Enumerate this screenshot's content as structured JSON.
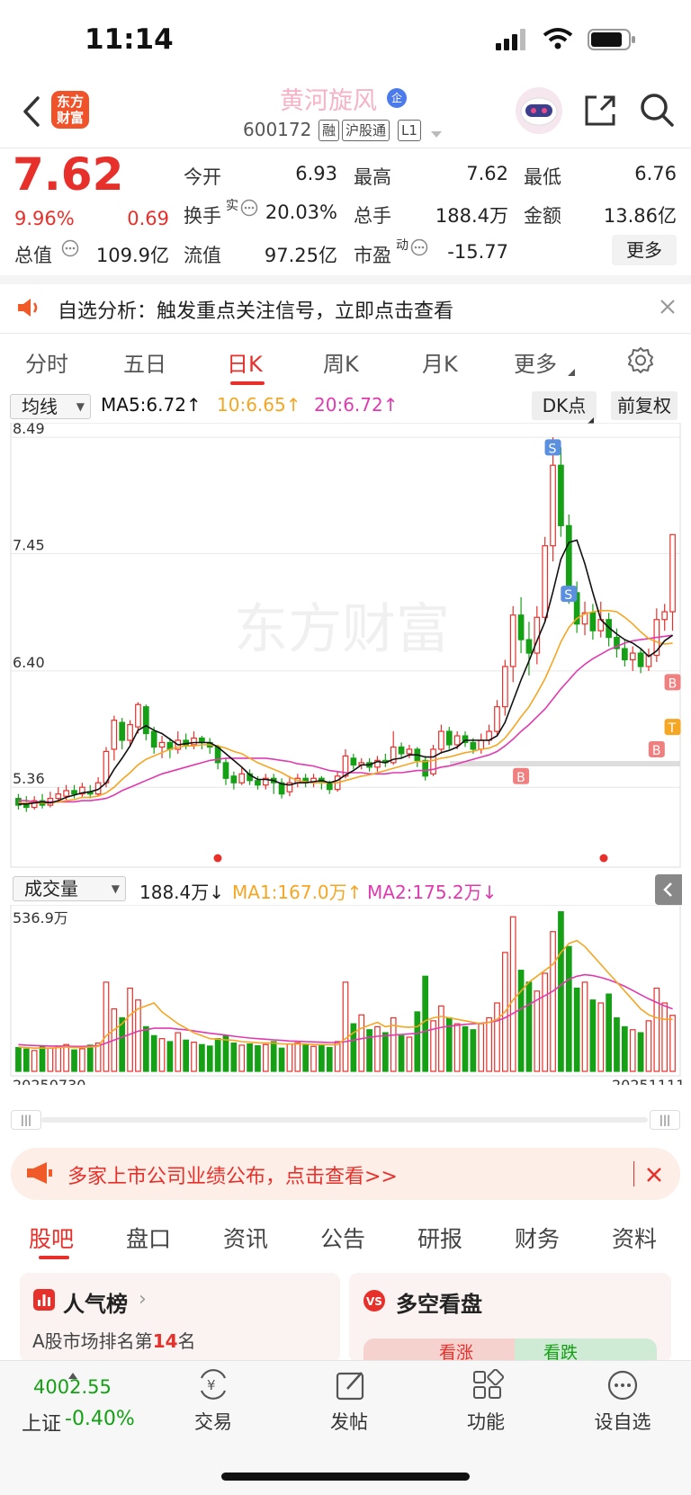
{
  "status_bar": {
    "time": "11:14"
  },
  "header": {
    "logo_text": "东方财富",
    "stock_name": "黄河旋风",
    "name_badge": "企",
    "stock_code": "600172",
    "tags": [
      "融",
      "沪股通",
      "L1"
    ]
  },
  "quote": {
    "price": "7.62",
    "change_pct": "9.96%",
    "change_amt": "0.69",
    "market_cap_label": "总值",
    "market_cap_value": "109.9亿",
    "open_label": "今开",
    "open_value": "6.93",
    "high_label": "最高",
    "high_value": "7.62",
    "low_label": "最低",
    "low_value": "6.76",
    "turnover_label": "换手",
    "turnover_sup": "实",
    "turnover_value": "20.03%",
    "volume_label": "总手",
    "volume_value": "188.4万",
    "amount_label": "金额",
    "amount_value": "13.86亿",
    "float_label": "流值",
    "float_value": "97.25亿",
    "pe_label": "市盈",
    "pe_sup": "动",
    "pe_value": "-15.77",
    "more_button": "更多"
  },
  "notice": {
    "text": "自选分析：触发重点关注信号，立即点击查看"
  },
  "kline_tabs": [
    "分时",
    "五日",
    "日K",
    "周K",
    "月K",
    "更多"
  ],
  "active_kline_tab": "日K",
  "chart_controls": {
    "ma_select": "均线",
    "ma5": "MA5:6.72↑",
    "ma10": "10:6.65↑",
    "ma20": "20:6.72↑",
    "dk_button": "DK点",
    "adjust_button": "前复权",
    "vol_select": "成交量",
    "vol_value": "188.4万↓",
    "vol_ma1": "MA1:167.0万↑",
    "vol_ma2": "MA2:175.2万↓",
    "watermark": "东方财富"
  },
  "colors": {
    "up": "#e8302b",
    "down": "#15a015",
    "ma5": "#111111",
    "ma10": "#f5a623",
    "ma20": "#e03ab0"
  },
  "chart_data": {
    "type": "candlestick",
    "y_ticks": [
      "8.49",
      "7.45",
      "6.40",
      "5.36"
    ],
    "vol_max_label": "536.9万",
    "x_start": "20250730",
    "x_end": "20251111",
    "candles": [
      [
        5.26,
        5.2,
        5.3,
        5.16
      ],
      [
        5.22,
        5.18,
        5.28,
        5.14
      ],
      [
        5.18,
        5.24,
        5.28,
        5.16
      ],
      [
        5.24,
        5.2,
        5.3,
        5.17
      ],
      [
        5.2,
        5.26,
        5.32,
        5.18
      ],
      [
        5.26,
        5.3,
        5.36,
        5.22
      ],
      [
        5.28,
        5.33,
        5.38,
        5.24
      ],
      [
        5.33,
        5.3,
        5.38,
        5.26
      ],
      [
        5.3,
        5.36,
        5.4,
        5.27
      ],
      [
        5.32,
        5.3,
        5.38,
        5.26
      ],
      [
        5.3,
        5.4,
        5.45,
        5.28
      ],
      [
        5.4,
        5.68,
        5.72,
        5.36
      ],
      [
        5.7,
        5.96,
        6.0,
        5.6
      ],
      [
        5.94,
        5.78,
        5.98,
        5.7
      ],
      [
        5.78,
        5.92,
        5.96,
        5.72
      ],
      [
        5.9,
        6.1,
        6.12,
        5.84
      ],
      [
        6.08,
        5.84,
        6.1,
        5.78
      ],
      [
        5.86,
        5.72,
        5.9,
        5.66
      ],
      [
        5.72,
        5.76,
        5.82,
        5.62
      ],
      [
        5.76,
        5.7,
        5.8,
        5.62
      ],
      [
        5.7,
        5.78,
        5.86,
        5.66
      ],
      [
        5.78,
        5.74,
        5.84,
        5.7
      ],
      [
        5.74,
        5.8,
        5.86,
        5.7
      ],
      [
        5.8,
        5.76,
        5.82,
        5.7
      ],
      [
        5.76,
        5.72,
        5.8,
        5.66
      ],
      [
        5.72,
        5.58,
        5.74,
        5.52
      ],
      [
        5.58,
        5.44,
        5.62,
        5.38
      ],
      [
        5.46,
        5.4,
        5.5,
        5.34
      ],
      [
        5.4,
        5.48,
        5.54,
        5.38
      ],
      [
        5.48,
        5.42,
        5.52,
        5.38
      ],
      [
        5.42,
        5.38,
        5.46,
        5.34
      ],
      [
        5.38,
        5.44,
        5.48,
        5.34
      ],
      [
        5.44,
        5.4,
        5.48,
        5.3
      ],
      [
        5.4,
        5.3,
        5.44,
        5.26
      ],
      [
        5.32,
        5.4,
        5.46,
        5.28
      ],
      [
        5.4,
        5.44,
        5.48,
        5.36
      ],
      [
        5.44,
        5.4,
        5.48,
        5.36
      ],
      [
        5.4,
        5.44,
        5.48,
        5.36
      ],
      [
        5.44,
        5.4,
        5.46,
        5.34
      ],
      [
        5.4,
        5.34,
        5.42,
        5.3
      ],
      [
        5.34,
        5.46,
        5.5,
        5.32
      ],
      [
        5.46,
        5.64,
        5.7,
        5.44
      ],
      [
        5.62,
        5.56,
        5.66,
        5.52
      ],
      [
        5.56,
        5.58,
        5.62,
        5.52
      ],
      [
        5.58,
        5.54,
        5.62,
        5.5
      ],
      [
        5.54,
        5.6,
        5.64,
        5.5
      ],
      [
        5.6,
        5.58,
        5.66,
        5.54
      ],
      [
        5.58,
        5.72,
        5.86,
        5.56
      ],
      [
        5.72,
        5.66,
        5.76,
        5.62
      ],
      [
        5.66,
        5.7,
        5.74,
        5.62
      ],
      [
        5.7,
        5.6,
        5.72,
        5.54
      ],
      [
        5.6,
        5.46,
        5.64,
        5.42
      ],
      [
        5.48,
        5.7,
        5.74,
        5.46
      ],
      [
        5.7,
        5.86,
        5.92,
        5.66
      ],
      [
        5.86,
        5.74,
        5.9,
        5.7
      ],
      [
        5.74,
        5.82,
        5.86,
        5.7
      ],
      [
        5.82,
        5.76,
        5.86,
        5.72
      ],
      [
        5.76,
        5.7,
        5.8,
        5.66
      ],
      [
        5.7,
        5.78,
        5.84,
        5.66
      ],
      [
        5.78,
        5.86,
        5.92,
        5.74
      ],
      [
        5.86,
        6.08,
        6.14,
        5.82
      ],
      [
        6.08,
        6.44,
        6.5,
        6.0
      ],
      [
        6.44,
        6.9,
        6.98,
        6.3
      ],
      [
        6.9,
        6.68,
        7.06,
        6.56
      ],
      [
        6.68,
        6.56,
        6.84,
        6.36
      ],
      [
        6.56,
        6.88,
        6.98,
        6.46
      ],
      [
        6.88,
        7.52,
        7.6,
        6.84
      ],
      [
        7.52,
        8.24,
        8.49,
        7.38
      ],
      [
        8.24,
        7.7,
        8.4,
        7.6
      ],
      [
        7.7,
        7.1,
        7.8,
        7.0
      ],
      [
        7.1,
        6.82,
        7.2,
        6.74
      ],
      [
        6.82,
        6.92,
        7.02,
        6.72
      ],
      [
        6.92,
        6.76,
        7.0,
        6.68
      ],
      [
        6.76,
        6.86,
        7.02,
        6.7
      ],
      [
        6.86,
        6.7,
        6.92,
        6.62
      ],
      [
        6.7,
        6.6,
        6.78,
        6.52
      ],
      [
        6.6,
        6.5,
        6.68,
        6.44
      ],
      [
        6.5,
        6.56,
        6.62,
        6.4
      ],
      [
        6.56,
        6.44,
        6.6,
        6.38
      ],
      [
        6.44,
        6.54,
        6.6,
        6.4
      ],
      [
        6.54,
        6.86,
        6.96,
        6.48
      ],
      [
        6.86,
        6.93,
        7.0,
        6.76
      ],
      [
        6.93,
        7.62,
        7.62,
        6.76
      ]
    ],
    "ma5": [
      5.21,
      5.21,
      5.22,
      5.23,
      5.22,
      5.24,
      5.27,
      5.29,
      5.31,
      5.32,
      5.34,
      5.4,
      5.52,
      5.62,
      5.73,
      5.87,
      5.91,
      5.87,
      5.84,
      5.79,
      5.74,
      5.75,
      5.76,
      5.76,
      5.76,
      5.72,
      5.66,
      5.6,
      5.54,
      5.47,
      5.43,
      5.43,
      5.42,
      5.39,
      5.38,
      5.4,
      5.4,
      5.41,
      5.42,
      5.4,
      5.42,
      5.47,
      5.51,
      5.56,
      5.56,
      5.59,
      5.58,
      5.61,
      5.62,
      5.65,
      5.65,
      5.63,
      5.63,
      5.67,
      5.69,
      5.72,
      5.78,
      5.78,
      5.78,
      5.78,
      5.82,
      5.94,
      6.13,
      6.32,
      6.49,
      6.67,
      6.84,
      7.11,
      7.4,
      7.55,
      7.57,
      7.36,
      7.1,
      6.86,
      6.79,
      6.73,
      6.68,
      6.65,
      6.6,
      6.53,
      6.58,
      6.67,
      6.72
    ],
    "ma10": [
      5.22,
      5.22,
      5.22,
      5.22,
      5.22,
      5.23,
      5.24,
      5.25,
      5.27,
      5.27,
      5.28,
      5.31,
      5.36,
      5.43,
      5.49,
      5.56,
      5.61,
      5.64,
      5.67,
      5.7,
      5.72,
      5.73,
      5.73,
      5.74,
      5.74,
      5.73,
      5.71,
      5.68,
      5.66,
      5.62,
      5.58,
      5.55,
      5.52,
      5.49,
      5.45,
      5.42,
      5.41,
      5.4,
      5.4,
      5.4,
      5.4,
      5.42,
      5.44,
      5.46,
      5.47,
      5.49,
      5.51,
      5.53,
      5.55,
      5.57,
      5.59,
      5.59,
      5.6,
      5.62,
      5.63,
      5.65,
      5.67,
      5.68,
      5.7,
      5.71,
      5.74,
      5.8,
      5.89,
      5.99,
      6.08,
      6.2,
      6.33,
      6.49,
      6.66,
      6.79,
      6.87,
      6.91,
      6.93,
      6.94,
      6.94,
      6.93,
      6.88,
      6.82,
      6.75,
      6.69,
      6.66,
      6.64,
      6.65
    ],
    "ma20": [
      5.24,
      5.24,
      5.23,
      5.23,
      5.23,
      5.23,
      5.23,
      5.23,
      5.24,
      5.24,
      5.25,
      5.26,
      5.29,
      5.33,
      5.36,
      5.39,
      5.42,
      5.45,
      5.48,
      5.5,
      5.52,
      5.54,
      5.56,
      5.58,
      5.6,
      5.61,
      5.62,
      5.62,
      5.62,
      5.62,
      5.62,
      5.62,
      5.61,
      5.6,
      5.59,
      5.57,
      5.56,
      5.55,
      5.53,
      5.51,
      5.5,
      5.49,
      5.49,
      5.49,
      5.48,
      5.48,
      5.48,
      5.49,
      5.49,
      5.5,
      5.51,
      5.51,
      5.52,
      5.54,
      5.55,
      5.57,
      5.59,
      5.61,
      5.63,
      5.65,
      5.68,
      5.73,
      5.79,
      5.86,
      5.92,
      5.99,
      6.06,
      6.15,
      6.24,
      6.32,
      6.4,
      6.46,
      6.51,
      6.55,
      6.59,
      6.62,
      6.65,
      6.67,
      6.68,
      6.69,
      6.7,
      6.71,
      6.72
    ],
    "volumes": [
      80,
      75,
      70,
      85,
      78,
      82,
      90,
      72,
      76,
      88,
      95,
      300,
      210,
      180,
      280,
      240,
      150,
      120,
      110,
      100,
      130,
      105,
      98,
      90,
      85,
      110,
      120,
      95,
      88,
      92,
      86,
      90,
      100,
      78,
      92,
      96,
      88,
      84,
      90,
      80,
      100,
      300,
      160,
      190,
      140,
      150,
      130,
      180,
      120,
      115,
      200,
      320,
      170,
      220,
      180,
      160,
      150,
      140,
      160,
      180,
      230,
      400,
      520,
      340,
      300,
      270,
      330,
      470,
      536.9,
      420,
      280,
      300,
      240,
      230,
      260,
      180,
      150,
      140,
      130,
      170,
      280,
      230,
      188.4
    ],
    "vol_ma1": [
      82,
      80,
      78,
      78,
      78,
      80,
      82,
      80,
      80,
      82,
      84,
      120,
      140,
      160,
      190,
      210,
      220,
      230,
      200,
      180,
      160,
      145,
      130,
      120,
      110,
      108,
      106,
      104,
      100,
      98,
      96,
      95,
      95,
      92,
      92,
      92,
      92,
      90,
      90,
      89,
      90,
      110,
      130,
      145,
      155,
      165,
      150,
      155,
      150,
      148,
      150,
      170,
      180,
      185,
      180,
      175,
      170,
      165,
      160,
      165,
      175,
      200,
      240,
      270,
      300,
      320,
      340,
      360,
      400,
      430,
      440,
      420,
      390,
      360,
      330,
      300,
      270,
      240,
      210,
      190,
      180,
      175,
      175.2
    ],
    "vol_ma2": [
      90,
      88,
      87,
      86,
      85,
      85,
      85,
      84,
      84,
      85,
      86,
      95,
      105,
      115,
      125,
      135,
      140,
      145,
      145,
      145,
      142,
      140,
      136,
      132,
      128,
      125,
      122,
      118,
      115,
      112,
      110,
      108,
      106,
      104,
      102,
      101,
      100,
      99,
      98,
      97,
      97,
      100,
      105,
      110,
      114,
      118,
      120,
      122,
      124,
      126,
      128,
      135,
      142,
      148,
      152,
      155,
      158,
      160,
      162,
      165,
      170,
      180,
      195,
      210,
      225,
      240,
      255,
      270,
      290,
      310,
      320,
      325,
      322,
      316,
      308,
      298,
      286,
      272,
      258,
      244,
      232,
      220,
      210
    ]
  },
  "signals": [
    "S",
    "S",
    "B",
    "B",
    "T",
    "B"
  ],
  "announcement": {
    "text": "多家上市公司业绩公布，点击查看>>"
  },
  "bottom_tabs": [
    "股吧",
    "盘口",
    "资讯",
    "公告",
    "研报",
    "财务",
    "资料"
  ],
  "cards": {
    "popularity_title": "人气榜",
    "popularity_sub_prefix": "A股市场排名第",
    "popularity_rank": "14",
    "popularity_sub_suffix": "名",
    "sentiment_title": "多空看盘",
    "bull_label": "看涨",
    "bear_label": "看跌"
  },
  "bottom_nav": {
    "index_value": "4002.55",
    "index_name": "上证",
    "index_change": "-0.40%",
    "trade": "交易",
    "post": "发帖",
    "features": "功能",
    "watchlist": "设自选"
  }
}
